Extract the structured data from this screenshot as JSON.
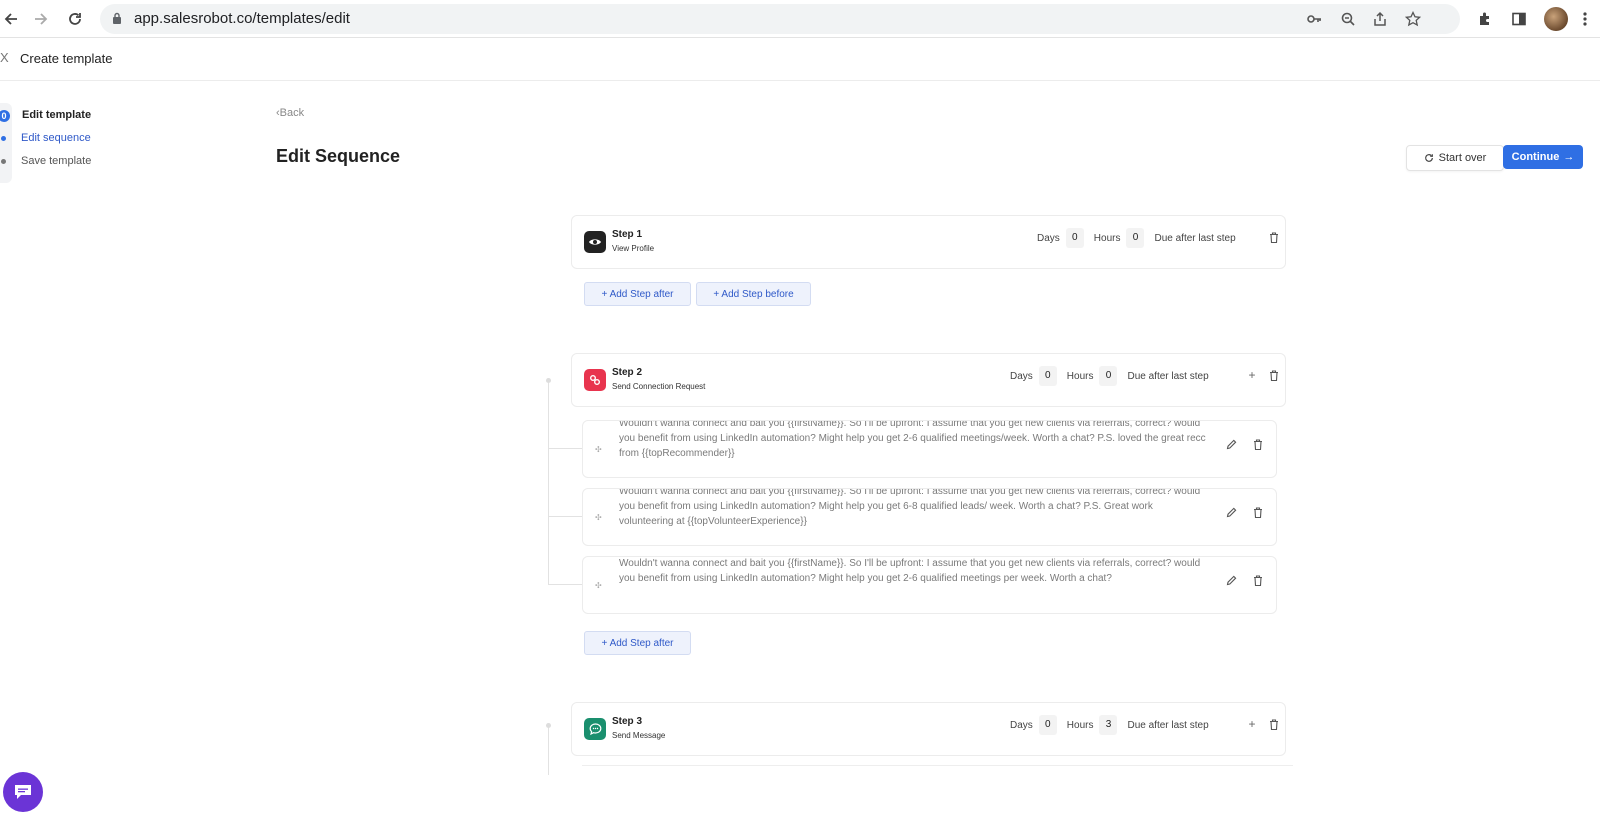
{
  "browser": {
    "url": "app.salesrobot.co/templates/edit"
  },
  "header": {
    "title": "Create template",
    "close_label": "X"
  },
  "stepper": {
    "items": [
      {
        "label": "Edit template",
        "marker": "0"
      },
      {
        "label": "Edit sequence"
      },
      {
        "label": "Save template"
      }
    ]
  },
  "page": {
    "back_label": "Back",
    "title": "Edit Sequence",
    "start_over_label": "Start over",
    "continue_label": "Continue"
  },
  "labels": {
    "days": "Days",
    "hours": "Hours",
    "due": "Due after last step",
    "add_after": "+ Add Step after",
    "add_before": "+ Add Step before"
  },
  "steps": [
    {
      "title": "Step 1",
      "subtitle": "View Profile",
      "days": "0",
      "hours": "0"
    },
    {
      "title": "Step 2",
      "subtitle": "Send Connection Request",
      "days": "0",
      "hours": "0",
      "messages": [
        "Wouldn't wanna connect and bait you {{firstName}}. So I'll be upfront: I assume that you get new clients via referrals, correct? would you benefit from using LinkedIn automation? Might help you get 2-6 qualified meetings/week. Worth a chat? P.S. loved the great recc from {{topRecommender}}",
        "Wouldn't wanna connect and bait you {{firstName}}. So I'll be upfront: I assume that you get new clients via referrals, correct? would you benefit from using LinkedIn automation? Might help you get 6-8 qualified leads/ week. Worth a chat? P.S. Great work volunteering at {{topVolunteerExperience}}",
        "Wouldn't wanna connect and bait you {{firstName}}. So I'll be upfront: I assume that you get new clients via referrals, correct? would you benefit from using LinkedIn automation? Might help you get 2-6 qualified meetings per week. Worth a chat?"
      ]
    },
    {
      "title": "Step 3",
      "subtitle": "Send Message",
      "days": "0",
      "hours": "3"
    }
  ],
  "colors": {
    "accent": "#2f6fe4",
    "step1_icon": "#222222",
    "step2_icon": "#e8344e",
    "step3_icon": "#1a8f6e",
    "chat_fab": "#6b34d6"
  }
}
